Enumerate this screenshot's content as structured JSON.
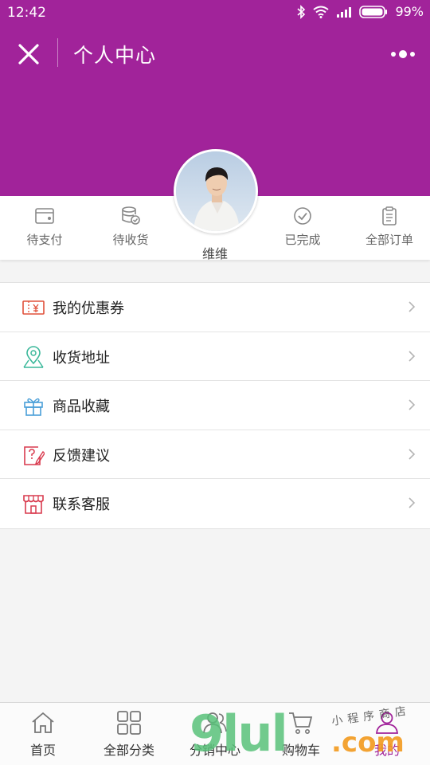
{
  "status_bar": {
    "time": "12:42",
    "battery": "99%"
  },
  "nav": {
    "title": "个人中心"
  },
  "theme": {
    "header_color": "#a1239a"
  },
  "user": {
    "name": "维维"
  },
  "orders": [
    {
      "label": "待支付",
      "icon": "wallet-icon"
    },
    {
      "label": "待收货",
      "icon": "coins-check-icon"
    },
    {
      "label": "已完成",
      "icon": "check-circle-icon"
    },
    {
      "label": "全部订单",
      "icon": "clipboard-icon"
    }
  ],
  "menu": [
    {
      "label": "我的优惠券",
      "icon": "coupon-icon",
      "color": "#e0503a"
    },
    {
      "label": "收货地址",
      "icon": "map-pin-icon",
      "color": "#3ab89a"
    },
    {
      "label": "商品收藏",
      "icon": "gift-icon",
      "color": "#4a9fd8"
    },
    {
      "label": "反馈建议",
      "icon": "feedback-icon",
      "color": "#d93a4e"
    },
    {
      "label": "联系客服",
      "icon": "store-icon",
      "color": "#d93a4e"
    }
  ],
  "tabs": [
    {
      "label": "首页",
      "icon": "home-icon"
    },
    {
      "label": "全部分类",
      "icon": "grid-icon"
    },
    {
      "label": "分销中心",
      "icon": "people-icon"
    },
    {
      "label": "购物车",
      "icon": "cart-icon"
    },
    {
      "label": "我的",
      "icon": "user-icon"
    }
  ],
  "watermark": {
    "main": "9lul",
    "suffix": ".com",
    "handwriting": "小程序商店"
  }
}
